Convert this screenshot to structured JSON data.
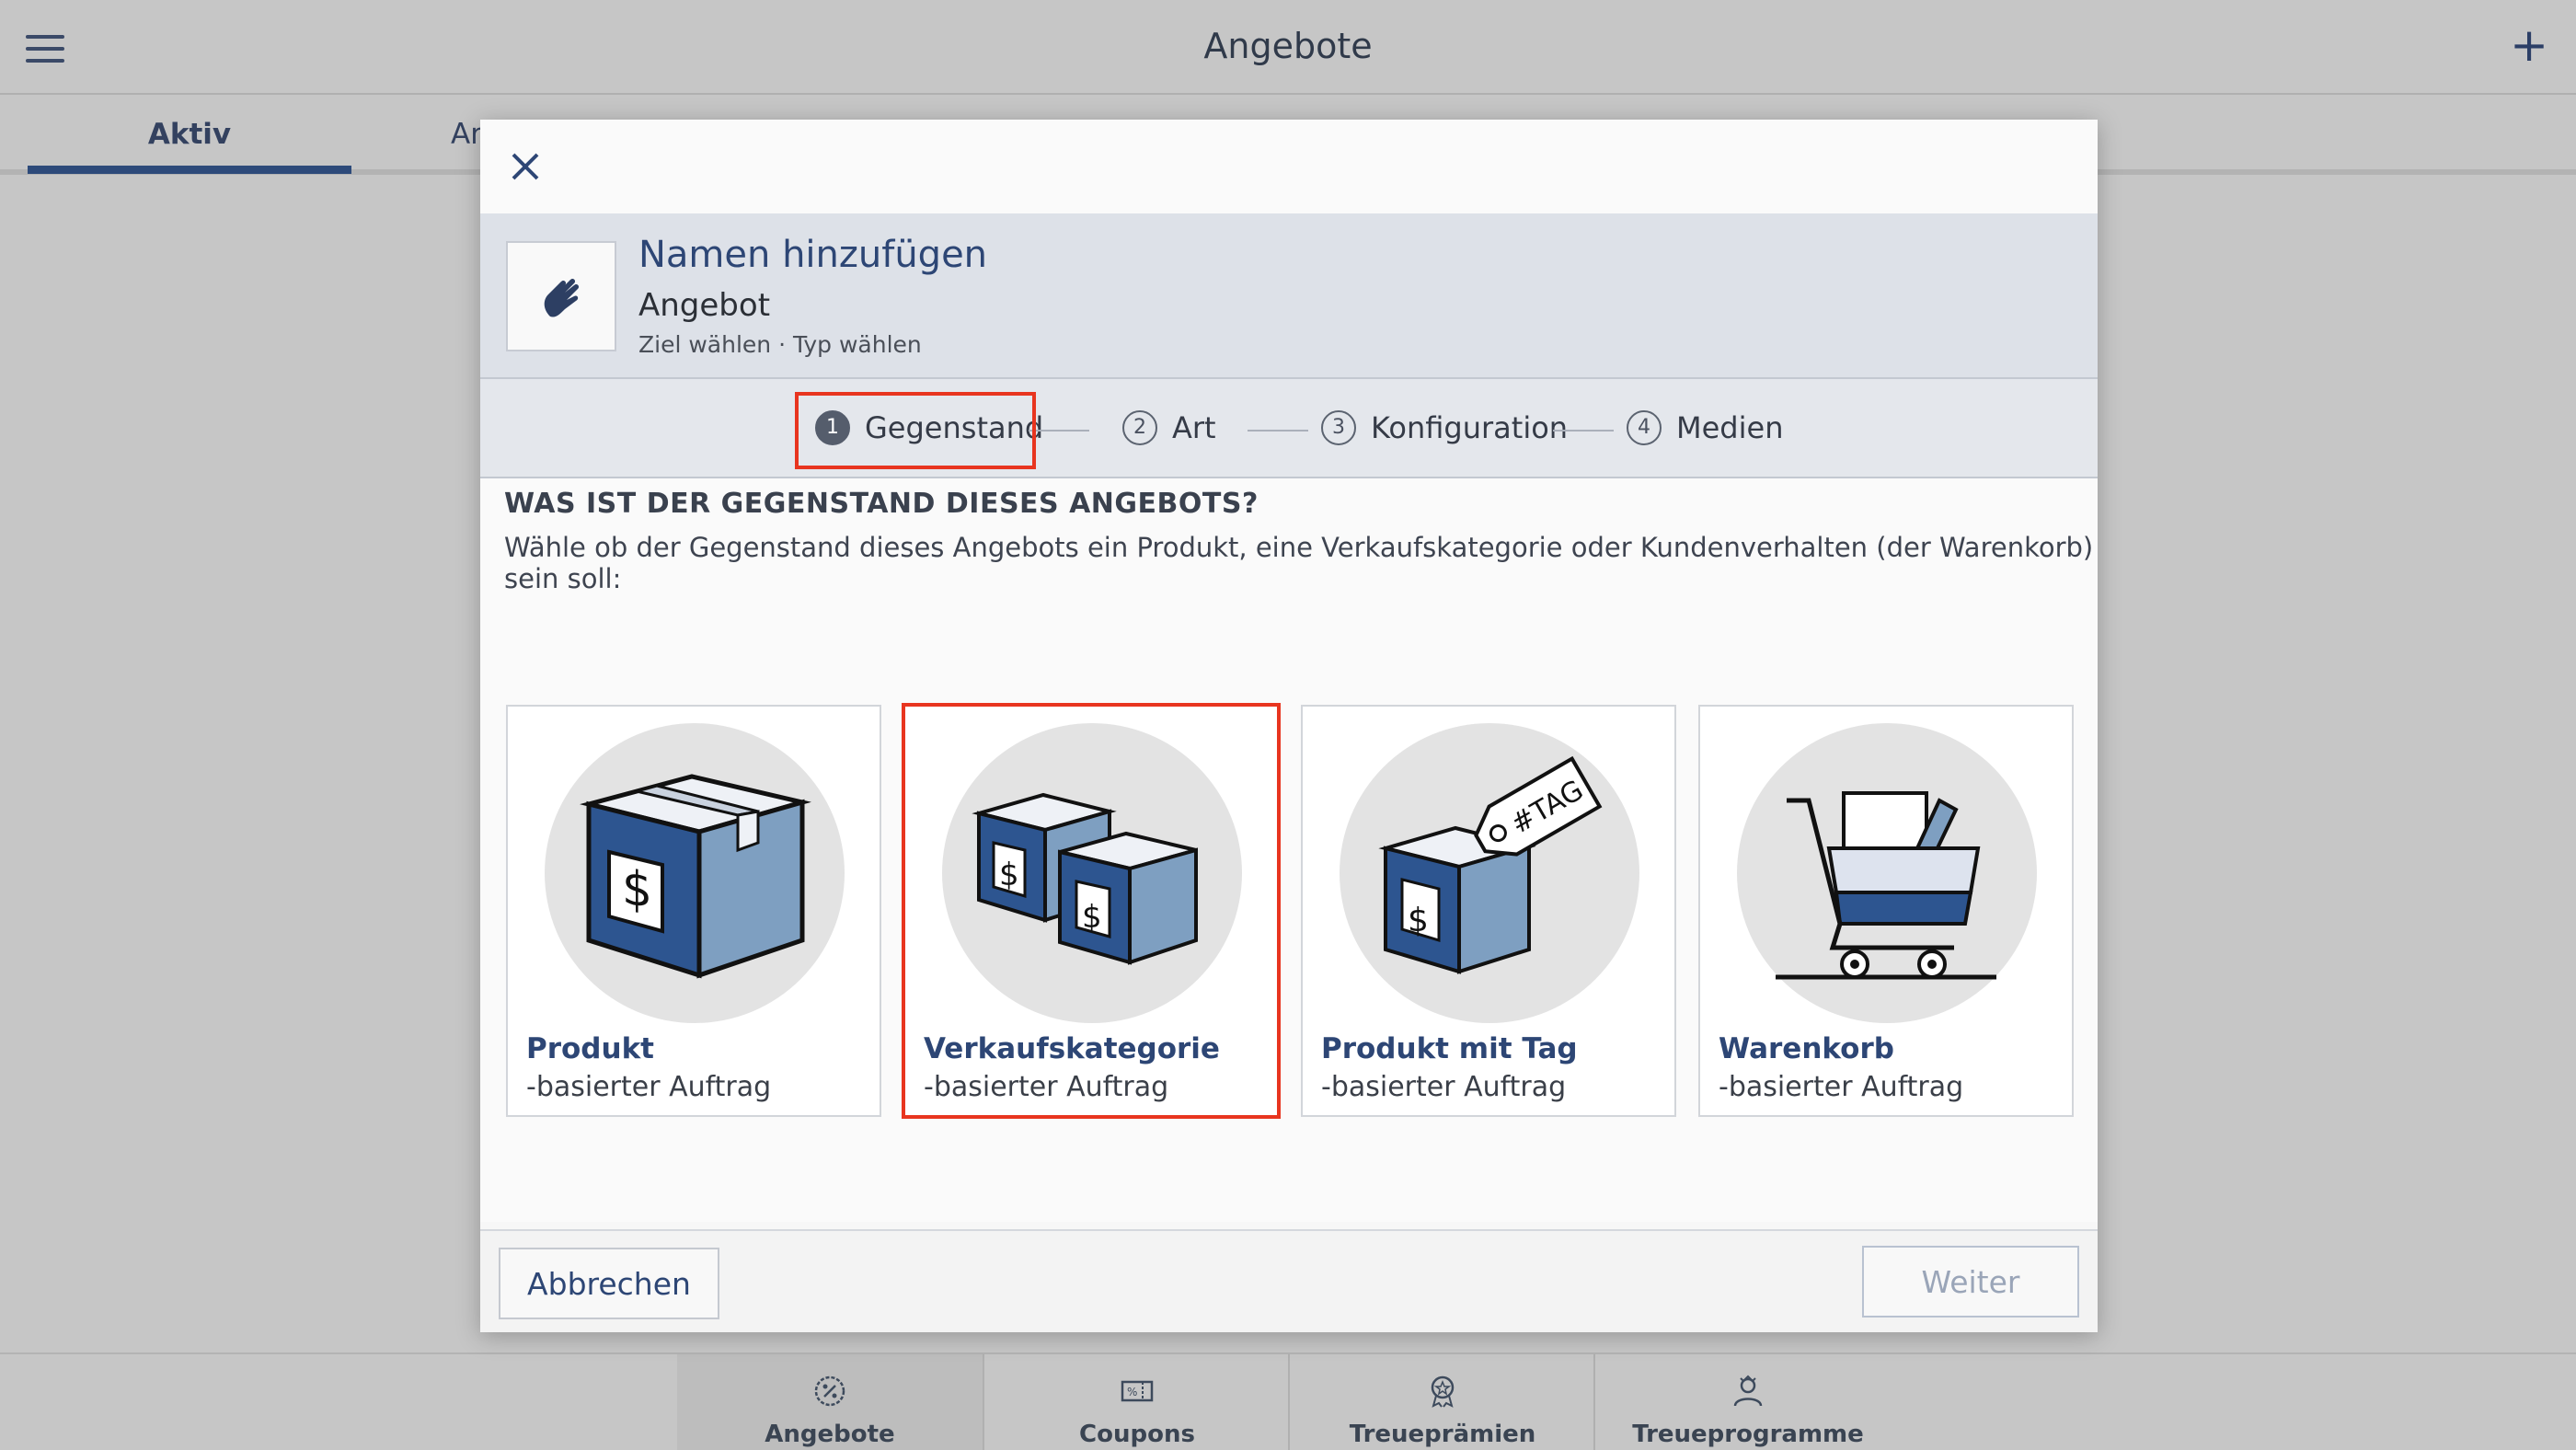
{
  "app": {
    "title": "Angebote",
    "tabs": [
      {
        "label": "Aktiv",
        "active": true
      },
      {
        "label": "Ar",
        "active": false
      }
    ]
  },
  "bottom_nav": [
    {
      "label": "Angebote",
      "icon": "percent-badge-icon",
      "active": true
    },
    {
      "label": "Coupons",
      "icon": "coupon-icon",
      "active": false
    },
    {
      "label": "Treueprämien",
      "icon": "award-icon",
      "active": false
    },
    {
      "label": "Treueprogramme",
      "icon": "member-icon",
      "active": false
    }
  ],
  "modal": {
    "header": {
      "title": "Namen hinzufügen",
      "subtitle": "Angebot",
      "meta": "Ziel wählen · Typ wählen",
      "icon": "hand-icon"
    },
    "steps": [
      {
        "number": "1",
        "label": "Gegenstand",
        "active": true
      },
      {
        "number": "2",
        "label": "Art",
        "active": false
      },
      {
        "number": "3",
        "label": "Konfiguration",
        "active": false
      },
      {
        "number": "4",
        "label": "Medien",
        "active": false
      }
    ],
    "question": "WAS IST DER GEGENSTAND DIESES ANGEBOTS?",
    "description": "Wähle ob der Gegenstand dieses Angebots ein Produkt, eine Verkaufskategorie oder Kundenverhalten (der Warenkorb) sein soll:",
    "options": [
      {
        "title": "Produkt",
        "subtitle": "-basierter Auftrag",
        "icon": "box-dollar-icon",
        "highlighted": false
      },
      {
        "title": "Verkaufskategorie",
        "subtitle": "-basierter Auftrag",
        "icon": "boxes-dollar-icon",
        "highlighted": true
      },
      {
        "title": "Produkt mit Tag",
        "subtitle": "-basierter Auftrag",
        "icon": "box-tag-icon",
        "tag_text": "#TAG",
        "highlighted": false
      },
      {
        "title": "Warenkorb",
        "subtitle": "-basierter Auftrag",
        "icon": "shopping-cart-icon",
        "highlighted": false
      }
    ],
    "footer": {
      "cancel_label": "Abbrechen",
      "next_label": "Weiter"
    }
  },
  "colors": {
    "accent": "#2d4675",
    "highlight": "#e8351f",
    "box_dark": "#2d5590",
    "box_light": "#7e9fc1"
  }
}
